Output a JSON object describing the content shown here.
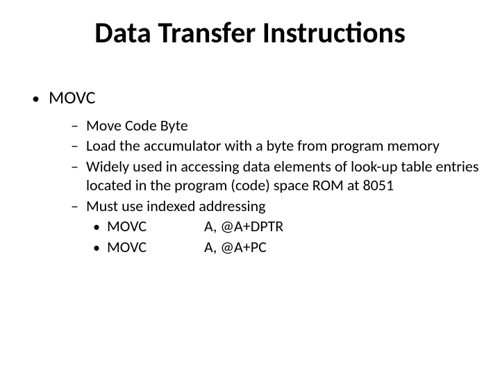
{
  "title": "Data Transfer Instructions",
  "topic": {
    "bullet": "•",
    "label": "MOVC"
  },
  "dash": "–",
  "dot": "•",
  "subs": {
    "s0": "Move Code Byte",
    "s1": "Load the accumulator with a byte from program memory",
    "s2": "Widely used in accessing data elements of look-up table entries located in the program (code) space ROM at 8051",
    "s3": "Must use indexed addressing"
  },
  "cmds": {
    "c0": {
      "name": "MOVC",
      "args": "A, @A+DPTR"
    },
    "c1": {
      "name": "MOVC",
      "args": "A, @A+PC"
    }
  }
}
